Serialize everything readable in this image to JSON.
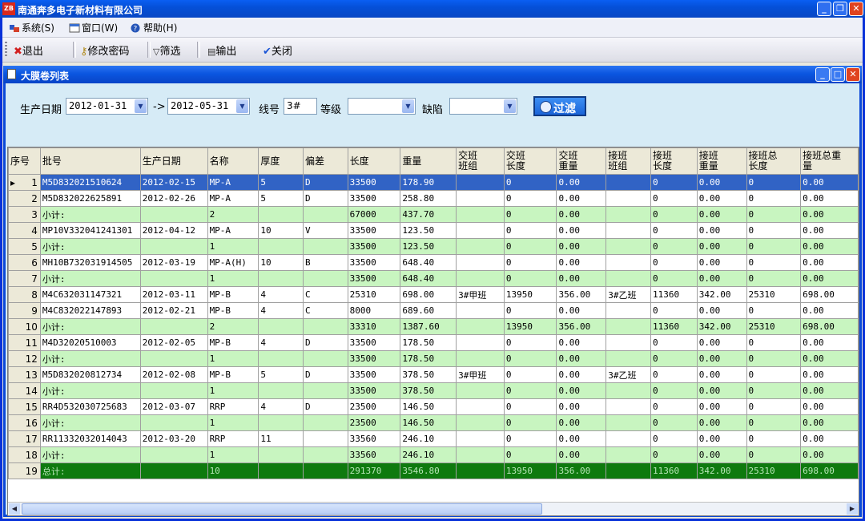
{
  "window": {
    "title": "南通奔多电子新材料有限公司",
    "icon_text": "ZB"
  },
  "menu": [
    {
      "label": "系统(S)",
      "icon": "system-icon"
    },
    {
      "label": "窗口(W)",
      "icon": "window-icon"
    },
    {
      "label": "帮助(H)",
      "icon": "help-icon"
    }
  ],
  "toolbar": {
    "exit": "退出",
    "change_password": "修改密码",
    "filter": "筛选",
    "export": "输出",
    "close": "关闭"
  },
  "child": {
    "title": "大膜卷列表"
  },
  "filter": {
    "date_label": "生产日期",
    "date_from": "2012-01-31",
    "arrow": "->",
    "date_to": "2012-05-31",
    "line_label": "线号",
    "line_value": "3#",
    "grade_label": "等级",
    "grade_value": "",
    "defect_label": "缺陷",
    "defect_value": "",
    "go_label": "过滤"
  },
  "grid": {
    "columns": [
      "序号",
      "批号",
      "生产日期",
      "名称",
      "厚度",
      "偏差",
      "长度",
      "重量",
      "交班\n班组",
      "交班\n长度",
      "交班\n重量",
      "接班\n班组",
      "接班\n长度",
      "接班\n重量",
      "接班总\n长度",
      "接班总重\n量"
    ],
    "rows": [
      {
        "type": "sel",
        "cells": [
          "1",
          "M5D832021510624",
          "2012-02-15",
          "MP-A",
          "5",
          "D",
          "33500",
          "178.90",
          "",
          "0",
          "0.00",
          "",
          "0",
          "0.00",
          "0",
          "0.00"
        ]
      },
      {
        "type": "row",
        "cells": [
          "2",
          "M5D832022625891",
          "2012-02-26",
          "MP-A",
          "5",
          "D",
          "33500",
          "258.80",
          "",
          "0",
          "0.00",
          "",
          "0",
          "0.00",
          "0",
          "0.00"
        ]
      },
      {
        "type": "sub",
        "cells": [
          "3",
          "小计:",
          "",
          "2",
          "",
          "",
          "67000",
          "437.70",
          "",
          "0",
          "0.00",
          "",
          "0",
          "0.00",
          "0",
          "0.00"
        ]
      },
      {
        "type": "row",
        "cells": [
          "4",
          "MP10V332041241301",
          "2012-04-12",
          "MP-A",
          "10",
          "V",
          "33500",
          "123.50",
          "",
          "0",
          "0.00",
          "",
          "0",
          "0.00",
          "0",
          "0.00"
        ]
      },
      {
        "type": "sub",
        "cells": [
          "5",
          "小计:",
          "",
          "1",
          "",
          "",
          "33500",
          "123.50",
          "",
          "0",
          "0.00",
          "",
          "0",
          "0.00",
          "0",
          "0.00"
        ]
      },
      {
        "type": "row",
        "cells": [
          "6",
          "MH10B732031914505",
          "2012-03-19",
          "MP-A(H)",
          "10",
          "B",
          "33500",
          "648.40",
          "",
          "0",
          "0.00",
          "",
          "0",
          "0.00",
          "0",
          "0.00"
        ]
      },
      {
        "type": "sub",
        "cells": [
          "7",
          "小计:",
          "",
          "1",
          "",
          "",
          "33500",
          "648.40",
          "",
          "0",
          "0.00",
          "",
          "0",
          "0.00",
          "0",
          "0.00"
        ]
      },
      {
        "type": "row",
        "cells": [
          "8",
          "M4C632031147321",
          "2012-03-11",
          "MP-B",
          "4",
          "C",
          "25310",
          "698.00",
          "3#甲班",
          "13950",
          "356.00",
          "3#乙班",
          "11360",
          "342.00",
          "25310",
          "698.00"
        ]
      },
      {
        "type": "row",
        "cells": [
          "9",
          "M4C832022147893",
          "2012-02-21",
          "MP-B",
          "4",
          "C",
          "8000",
          "689.60",
          "",
          "0",
          "0.00",
          "",
          "0",
          "0.00",
          "0",
          "0.00"
        ]
      },
      {
        "type": "sub",
        "cells": [
          "10",
          "小计:",
          "",
          "2",
          "",
          "",
          "33310",
          "1387.60",
          "",
          "13950",
          "356.00",
          "",
          "11360",
          "342.00",
          "25310",
          "698.00"
        ]
      },
      {
        "type": "row",
        "cells": [
          "11",
          "M4D32020510003",
          "2012-02-05",
          "MP-B",
          "4",
          "D",
          "33500",
          "178.50",
          "",
          "0",
          "0.00",
          "",
          "0",
          "0.00",
          "0",
          "0.00"
        ]
      },
      {
        "type": "sub",
        "cells": [
          "12",
          "小计:",
          "",
          "1",
          "",
          "",
          "33500",
          "178.50",
          "",
          "0",
          "0.00",
          "",
          "0",
          "0.00",
          "0",
          "0.00"
        ]
      },
      {
        "type": "row",
        "cells": [
          "13",
          "M5D832020812734",
          "2012-02-08",
          "MP-B",
          "5",
          "D",
          "33500",
          "378.50",
          "3#甲班",
          "0",
          "0.00",
          "3#乙班",
          "0",
          "0.00",
          "0",
          "0.00"
        ]
      },
      {
        "type": "sub",
        "cells": [
          "14",
          "小计:",
          "",
          "1",
          "",
          "",
          "33500",
          "378.50",
          "",
          "0",
          "0.00",
          "",
          "0",
          "0.00",
          "0",
          "0.00"
        ]
      },
      {
        "type": "row",
        "cells": [
          "15",
          "RR4D532030725683",
          "2012-03-07",
          "RRP",
          "4",
          "D",
          "23500",
          "146.50",
          "",
          "0",
          "0.00",
          "",
          "0",
          "0.00",
          "0",
          "0.00"
        ]
      },
      {
        "type": "sub",
        "cells": [
          "16",
          "小计:",
          "",
          "1",
          "",
          "",
          "23500",
          "146.50",
          "",
          "0",
          "0.00",
          "",
          "0",
          "0.00",
          "0",
          "0.00"
        ]
      },
      {
        "type": "row",
        "cells": [
          "17",
          "RR11332032014043",
          "2012-03-20",
          "RRP",
          "11",
          "",
          "33560",
          "246.10",
          "",
          "0",
          "0.00",
          "",
          "0",
          "0.00",
          "0",
          "0.00"
        ]
      },
      {
        "type": "sub",
        "cells": [
          "18",
          "小计:",
          "",
          "1",
          "",
          "",
          "33560",
          "246.10",
          "",
          "0",
          "0.00",
          "",
          "0",
          "0.00",
          "0",
          "0.00"
        ]
      },
      {
        "type": "tot",
        "cells": [
          "19",
          "总计:",
          "",
          "10",
          "",
          "",
          "291370",
          "3546.80",
          "",
          "13950",
          "356.00",
          "",
          "11360",
          "342.00",
          "25310",
          "698.00"
        ]
      }
    ]
  }
}
